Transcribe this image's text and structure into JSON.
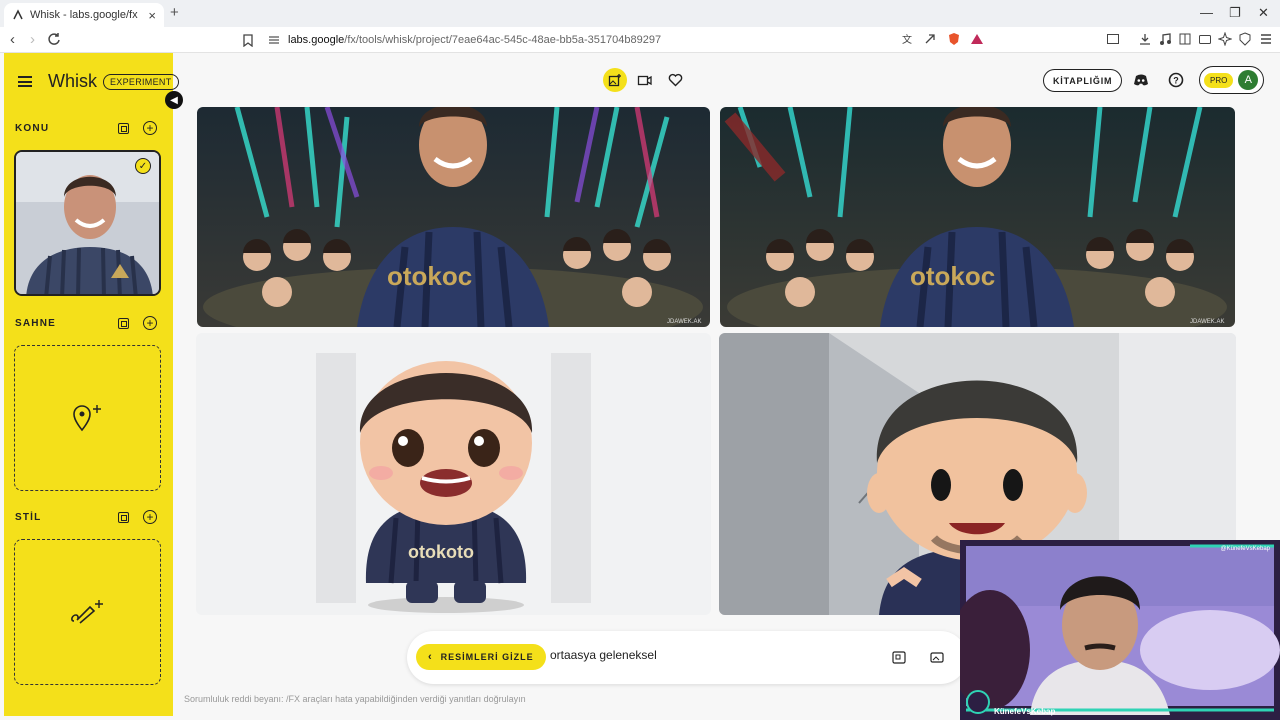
{
  "browser": {
    "tab_title": "Whisk - labs.google/fx",
    "url_host": "labs.google",
    "url_path": "/fx/tools/whisk/project/7eae64ac-545c-48ae-bb5a-351704b89297",
    "new_tab": "+",
    "close_tab": "×"
  },
  "app": {
    "brand": "Whisk",
    "badge": "EXPERIMENT",
    "library_button": "KİTAPLIĞIM",
    "pro_label": "PRO",
    "avatar_initial": "A",
    "accent_color": "#f4e01a"
  },
  "sidebar": {
    "sections": [
      {
        "label": "KONU"
      },
      {
        "label": "SAHNE"
      },
      {
        "label": "STİL"
      }
    ]
  },
  "gallery": {
    "watermark": "JDAWEK.AK"
  },
  "prompt": {
    "hide_images_label": "RESİMLERİ GİZLE",
    "value": "ortaasya geleneksel"
  },
  "footer": {
    "disclaimer": "Sorumluluk reddi beyanı: /FX araçları hata yapabildiğinden verdiği yanıtları doğrulayın"
  },
  "webcam": {
    "name": "KünefeVsKebap",
    "handle": "@KünefeVsKebap"
  }
}
